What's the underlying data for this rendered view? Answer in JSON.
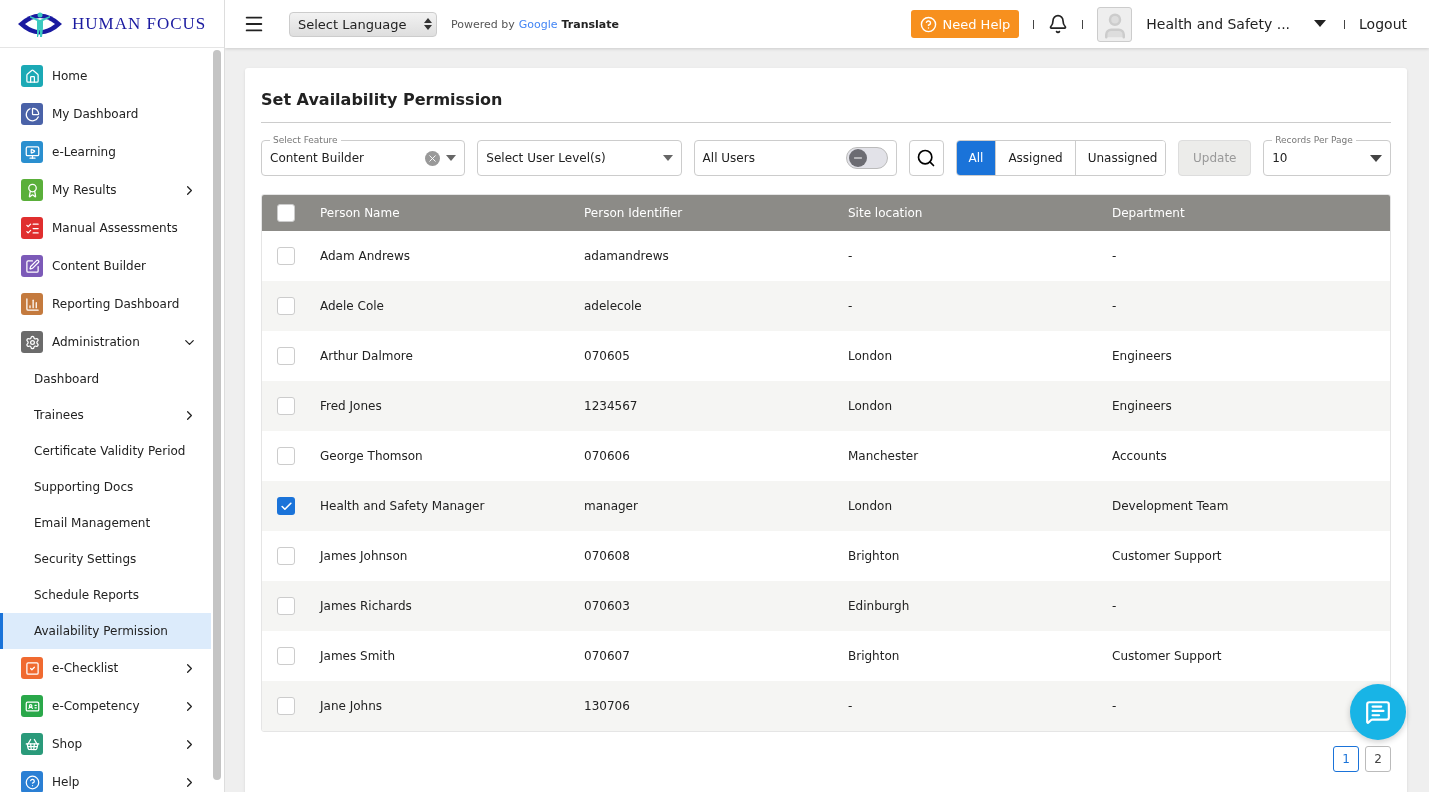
{
  "brand": {
    "name": "HUMAN FOCUS"
  },
  "topbar": {
    "language_select": {
      "value": "Select Language"
    },
    "powered_by": "Powered by",
    "google": "Google",
    "translate": "Translate",
    "help_button": "Need Help",
    "user_name": "Health and Safety ...",
    "logout": "Logout"
  },
  "sidebar": {
    "items": [
      {
        "kind": "main",
        "label": "Home",
        "color": "#1ba9b5",
        "selected": false
      },
      {
        "kind": "main",
        "label": "My Dashboard",
        "color": "#4a62a8",
        "selected": false
      },
      {
        "kind": "main",
        "label": "e-Learning",
        "color": "#2a8fcf",
        "selected": false
      },
      {
        "kind": "main",
        "label": "My Results",
        "color": "#5aaf3a",
        "expanded": false,
        "selected": false
      },
      {
        "kind": "main",
        "label": "Manual Assessments",
        "color": "#e02e2e",
        "selected": false
      },
      {
        "kind": "main",
        "label": "Content Builder",
        "color": "#7c5ab8",
        "selected": false
      },
      {
        "kind": "main",
        "label": "Reporting Dashboard",
        "color": "#c47a3e",
        "selected": false
      },
      {
        "kind": "main",
        "label": "Administration",
        "color": "#6b6b6b",
        "expanded": true,
        "selected": false
      },
      {
        "kind": "sub",
        "label": "Dashboard",
        "selected": false
      },
      {
        "kind": "sub",
        "label": "Trainees",
        "expanded": false,
        "selected": false
      },
      {
        "kind": "sub",
        "label": "Certificate Validity Period",
        "selected": false
      },
      {
        "kind": "sub",
        "label": "Supporting Docs",
        "selected": false
      },
      {
        "kind": "sub",
        "label": "Email Management",
        "selected": false
      },
      {
        "kind": "sub",
        "label": "Security Settings",
        "selected": false
      },
      {
        "kind": "sub",
        "label": "Schedule Reports",
        "selected": false
      },
      {
        "kind": "sub",
        "label": "Availability Permission",
        "selected": true
      },
      {
        "kind": "main",
        "label": "e-Checklist",
        "color": "#f06a30",
        "expanded": false,
        "selected": false
      },
      {
        "kind": "main",
        "label": "e-Competency",
        "color": "#2aa84a",
        "expanded": false,
        "selected": false
      },
      {
        "kind": "main",
        "label": "Shop",
        "color": "#2a9a7a",
        "expanded": false,
        "selected": false
      },
      {
        "kind": "main",
        "label": "Help",
        "color": "#2a7fd4",
        "expanded": false,
        "selected": false
      }
    ]
  },
  "page": {
    "title": "Set Availability Permission",
    "filters": {
      "feature": {
        "label": "Select Feature",
        "value": "Content Builder"
      },
      "user_level": {
        "placeholder": "Select User Level(s)"
      },
      "all_users": {
        "label": "All Users",
        "on": false
      },
      "segments": [
        {
          "label": "All",
          "selected": true
        },
        {
          "label": "Assigned",
          "selected": false
        },
        {
          "label": "Unassigned",
          "selected": false
        }
      ],
      "update": {
        "label": "Update",
        "disabled": true
      },
      "records_per_page": {
        "label": "Records Per Page",
        "value": "10"
      }
    },
    "table": {
      "header_checked": false,
      "columns": [
        "Person Name",
        "Person Identifier",
        "Site location",
        "Department"
      ],
      "rows": [
        {
          "checked": false,
          "cells": [
            "Adam Andrews",
            "adamandrews",
            "-",
            "-"
          ]
        },
        {
          "checked": false,
          "cells": [
            "Adele Cole",
            "adelecole",
            "-",
            "-"
          ]
        },
        {
          "checked": false,
          "cells": [
            "Arthur Dalmore",
            "070605",
            "London",
            "Engineers"
          ]
        },
        {
          "checked": false,
          "cells": [
            "Fred Jones",
            "1234567",
            "London",
            "Engineers"
          ]
        },
        {
          "checked": false,
          "cells": [
            "George Thomson",
            "070606",
            "Manchester",
            "Accounts"
          ]
        },
        {
          "checked": true,
          "cells": [
            "Health and Safety Manager",
            "manager",
            "London",
            "Development Team"
          ]
        },
        {
          "checked": false,
          "cells": [
            "James Johnson",
            "070608",
            "Brighton",
            "Customer Support"
          ]
        },
        {
          "checked": false,
          "cells": [
            "James Richards",
            "070603",
            "Edinburgh",
            "-"
          ]
        },
        {
          "checked": false,
          "cells": [
            "James Smith",
            "070607",
            "Brighton",
            "Customer Support"
          ]
        },
        {
          "checked": false,
          "cells": [
            "Jane Johns",
            "130706",
            "-",
            "-"
          ]
        }
      ]
    },
    "pagination": [
      {
        "label": "1",
        "selected": true
      },
      {
        "label": "2",
        "selected": false
      }
    ]
  }
}
